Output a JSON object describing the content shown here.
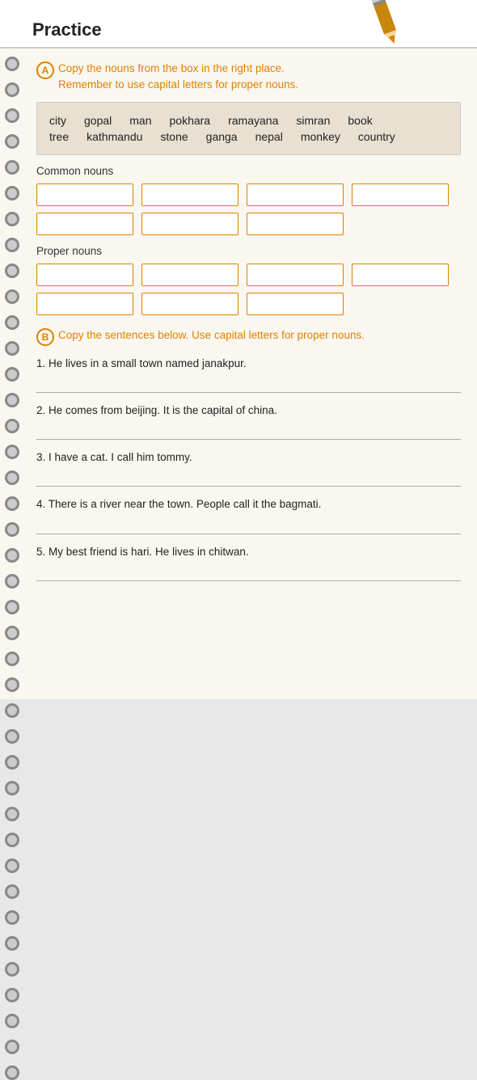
{
  "header": {
    "title": "Practice"
  },
  "sectionA": {
    "circle": "A",
    "instruction_line1": "Copy the nouns from the box in the right place.",
    "instruction_line2": "Remember to use capital letters for proper nouns.",
    "words_row1": [
      "city",
      "gopal",
      "man",
      "pokhara",
      "ramayana",
      "simran",
      "book"
    ],
    "words_row2": [
      "tree",
      "kathmandu",
      "stone",
      "ganga",
      "nepal",
      "monkey",
      "country"
    ],
    "common_nouns_label": "Common nouns",
    "proper_nouns_label": "Proper nouns"
  },
  "sectionB": {
    "circle": "B",
    "instruction": "Copy the sentences below. Use capital letters for proper nouns.",
    "sentences": [
      "1. He lives in a small town named janakpur.",
      "2. He comes from beijing. It is the capital of china.",
      "3. I have a cat. I call him tommy.",
      "4. There is a river near the town. People call it the bagmati.",
      "5. My best friend is hari. He lives in chitwan."
    ]
  },
  "colors": {
    "orange": "#e08000",
    "line_color": "#aaa"
  }
}
